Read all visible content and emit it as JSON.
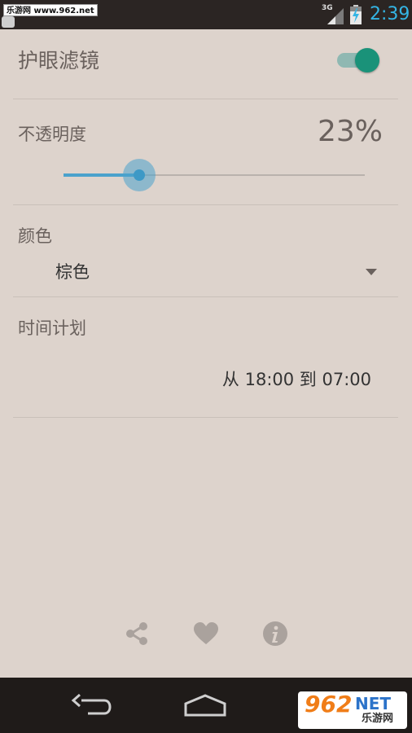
{
  "status_bar": {
    "watermark": "乐游网 www.962.net",
    "network": "3G",
    "time": "2:39"
  },
  "filter": {
    "title": "护眼滤镜",
    "enabled": true
  },
  "opacity": {
    "label": "不透明度",
    "value_text": "23%",
    "value": 0.25
  },
  "color": {
    "label": "颜色",
    "selected": "棕色"
  },
  "schedule": {
    "label": "时间计划",
    "range": "从 18:00 到 07:00"
  },
  "actions": {
    "share_icon": "share-icon",
    "favorite_icon": "heart-icon",
    "info_icon": "info-icon"
  },
  "watermark_logo": {
    "number": "962",
    "suffix": "NET",
    "name": "乐游网"
  },
  "colors": {
    "background": "#ddd3cc",
    "accent": "#1a9279",
    "slider": "#4aa2cc"
  }
}
